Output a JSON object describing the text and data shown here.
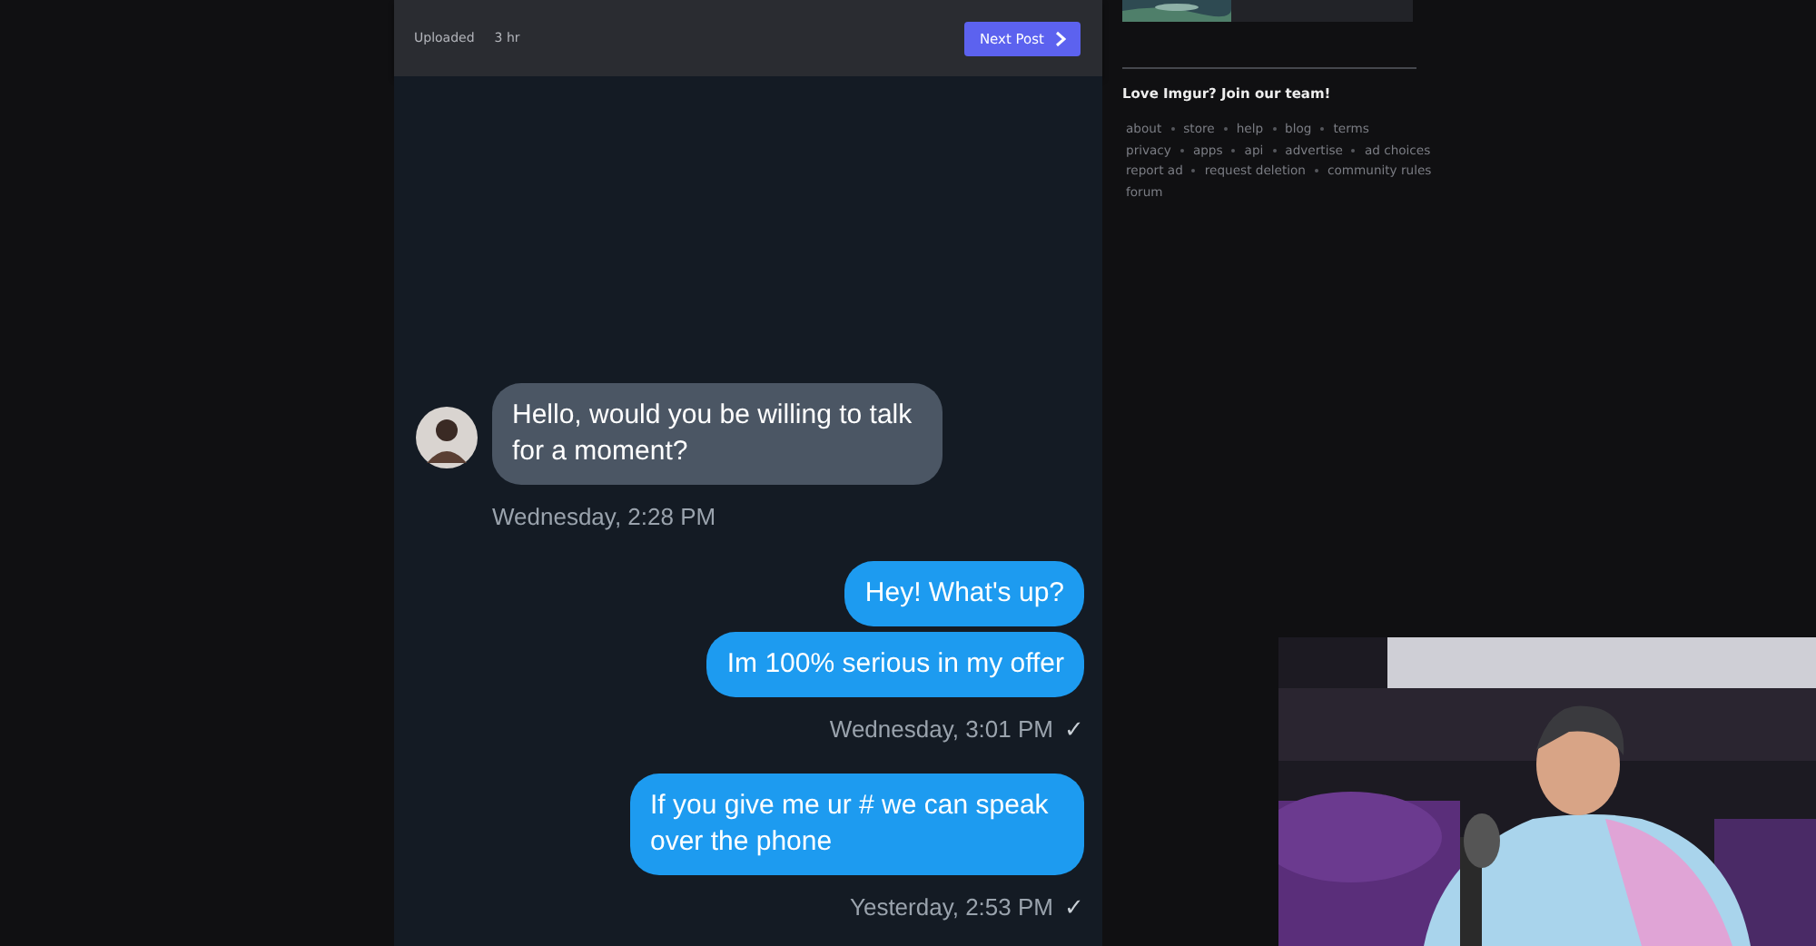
{
  "post_header": {
    "uploaded_label": "Uploaded",
    "uploaded_time": "3 hr",
    "next_button": "Next Post"
  },
  "conversation": [
    {
      "kind": "received",
      "avatar": true,
      "bubbles": [
        "Hello, would you be willing to talk for a moment?"
      ],
      "timestamp": "Wednesday, 2:28 PM"
    },
    {
      "kind": "sent",
      "bubbles": [
        "Hey! What's up?",
        "Im 100% serious in my offer"
      ],
      "timestamp": "Wednesday, 3:01 PM",
      "check": "✓"
    },
    {
      "kind": "sent",
      "bubbles": [
        "If you give me ur # we can speak over the phone"
      ],
      "timestamp": "Yesterday, 2:53 PM",
      "check": "✓"
    }
  ],
  "sidebar": {
    "thumbnail": {
      "kind": "picture"
    },
    "promo": "Love Imgur? Join our team!",
    "link_rows": [
      [
        "about",
        "store",
        "help",
        "blog",
        "terms"
      ],
      [
        "privacy",
        "apps",
        "api",
        "advertise",
        "ad choices"
      ],
      [
        "report ad",
        "request deletion",
        "community rules"
      ],
      [
        "forum"
      ]
    ]
  },
  "webcam": {
    "kind": "picture"
  }
}
